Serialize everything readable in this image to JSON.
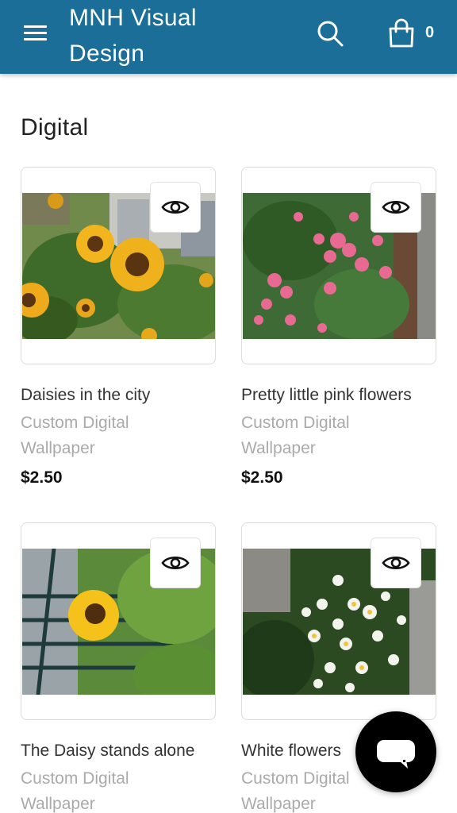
{
  "header": {
    "brand": "MNH Visual Design",
    "menu_icon": "hamburger-menu-icon",
    "search_icon": "search-icon",
    "cart_icon": "shopping-bag-icon",
    "cart_count": "0",
    "bg_color": "#1a6e97"
  },
  "section": {
    "title": "Digital"
  },
  "products": [
    {
      "title": "Daisies in the city",
      "subtitle": "Custom Digital Wallpaper",
      "price": "$2.50",
      "image": "sunflowers among buildings"
    },
    {
      "title": "Pretty little pink flowers",
      "subtitle": "Custom Digital Wallpaper",
      "price": "$2.50",
      "image": "pink begonias with green leaves"
    },
    {
      "title": "The Daisy stands alone",
      "subtitle": "Custom Digital Wallpaper",
      "price": "",
      "image": "single sunflower by a railing"
    },
    {
      "title": "White flowers",
      "subtitle": "Custom Digital Wallpaper",
      "price": "",
      "image": "white daisies with green foliage"
    }
  ],
  "quick_view_icon": "eye-icon",
  "chat": {
    "icon": "chat-bubble-icon"
  }
}
